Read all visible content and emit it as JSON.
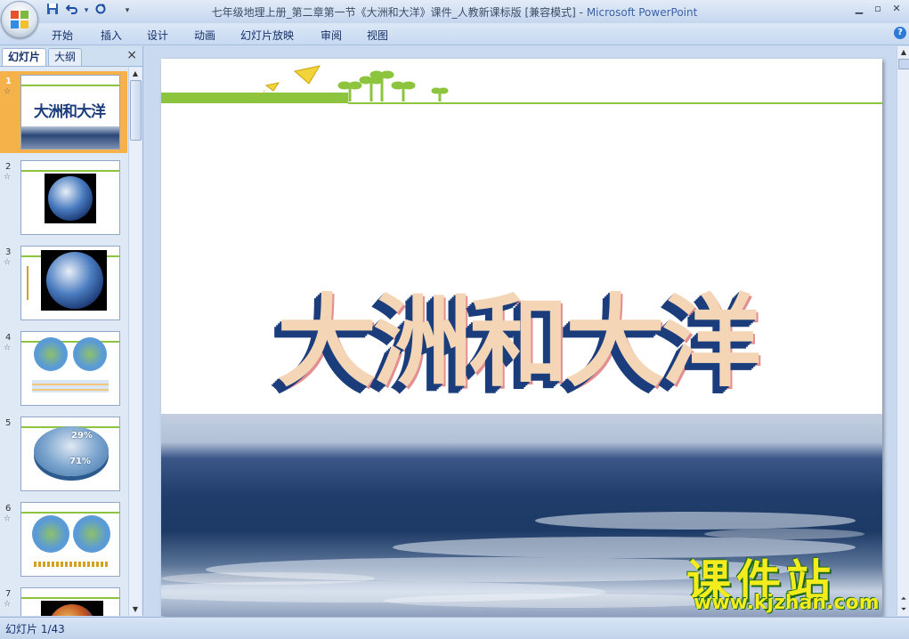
{
  "window": {
    "title": "七年级地理上册_第二章第一节《大洲和大洋》课件_人教新课标版 [兼容模式] - ",
    "app_name": "Microsoft PowerPoint"
  },
  "quick_access": {
    "save_icon": "save-icon",
    "undo_icon": "undo-icon",
    "redo_icon": "repeat-icon"
  },
  "ribbon": {
    "tabs": [
      "开始",
      "插入",
      "设计",
      "动画",
      "幻灯片放映",
      "审阅",
      "视图"
    ]
  },
  "left_pane": {
    "tabs": [
      "幻灯片",
      "大纲"
    ],
    "close_symbol": "×",
    "thumbnails": [
      {
        "number": "1",
        "title": "大洲和大洋"
      },
      {
        "number": "2"
      },
      {
        "number": "3"
      },
      {
        "number": "4"
      },
      {
        "number": "5",
        "label_top": "29%",
        "label_bottom": "71%"
      },
      {
        "number": "6"
      },
      {
        "number": "7"
      }
    ]
  },
  "slide": {
    "title": "大洲和大洋",
    "watermark_cn": "课件站",
    "watermark_url": "www.kjzhan.com"
  },
  "status": {
    "slide_counter": "幻灯片 1/43"
  },
  "colors": {
    "accent_green": "#8dc43e",
    "title_face": "#f4d6b6",
    "title_extrude": "#1b3d7c",
    "selection": "#f5b24a"
  }
}
